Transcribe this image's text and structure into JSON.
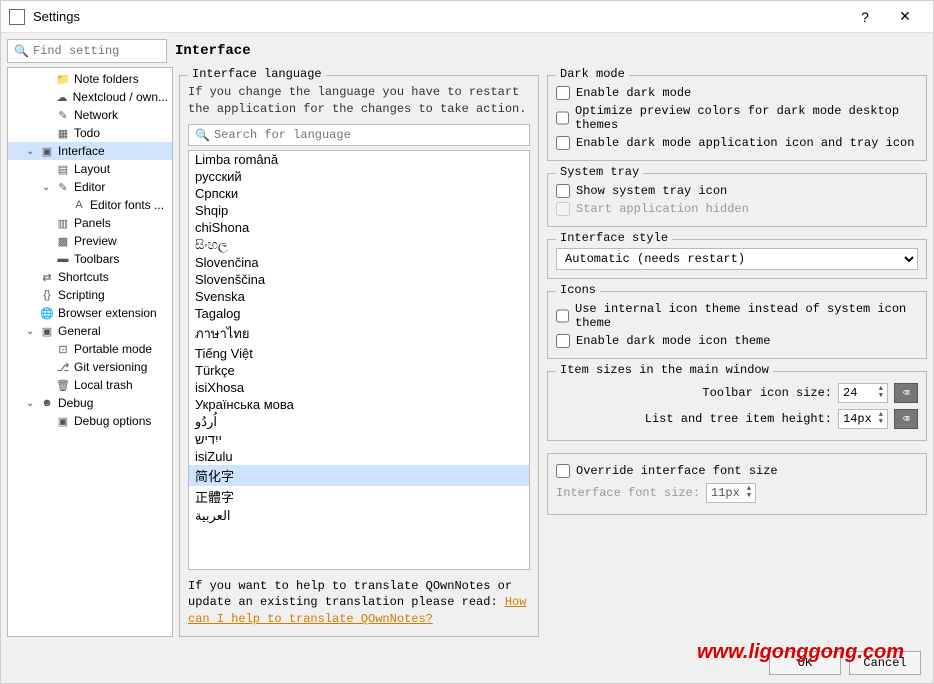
{
  "window": {
    "title": "Settings"
  },
  "search": {
    "placeholder": "Find setting"
  },
  "page_heading": "Interface",
  "sidebar": {
    "items": [
      {
        "label": "Note folders",
        "icon": "folder",
        "indent": 1
      },
      {
        "label": "Nextcloud / own...",
        "icon": "cloud",
        "indent": 1
      },
      {
        "label": "Network",
        "icon": "pen",
        "indent": 1
      },
      {
        "label": "Todo",
        "icon": "todo",
        "indent": 1
      },
      {
        "label": "Interface",
        "icon": "window",
        "indent": 0,
        "expanded": true,
        "selected": true
      },
      {
        "label": "Layout",
        "icon": "layout",
        "indent": 1
      },
      {
        "label": "Editor",
        "icon": "editor",
        "indent": 1,
        "expanded": true
      },
      {
        "label": "Editor fonts ...",
        "icon": "font",
        "indent": 2
      },
      {
        "label": "Panels",
        "icon": "panels",
        "indent": 1
      },
      {
        "label": "Preview",
        "icon": "preview",
        "indent": 1
      },
      {
        "label": "Toolbars",
        "icon": "toolbars",
        "indent": 1
      },
      {
        "label": "Shortcuts",
        "icon": "shortcuts",
        "indent": 0
      },
      {
        "label": "Scripting",
        "icon": "scripting",
        "indent": 0
      },
      {
        "label": "Browser extension",
        "icon": "globe",
        "indent": 0
      },
      {
        "label": "General",
        "icon": "general",
        "indent": 0,
        "expanded": true
      },
      {
        "label": "Portable mode",
        "icon": "portable",
        "indent": 1
      },
      {
        "label": "Git versioning",
        "icon": "git",
        "indent": 1
      },
      {
        "label": "Local trash",
        "icon": "trash",
        "indent": 1
      },
      {
        "label": "Debug",
        "icon": "debug",
        "indent": 0,
        "expanded": true
      },
      {
        "label": "Debug options",
        "icon": "debugopt",
        "indent": 1
      }
    ]
  },
  "lang_group": {
    "legend": "Interface language",
    "help": "If you change the language you have to restart the application for the changes to take action.",
    "search_placeholder": "Search for language",
    "items": [
      "Limba română",
      "русский",
      "Српски",
      "Shqip",
      "chiShona",
      "සිංහල",
      "Slovenčina",
      "Slovenščina",
      "Svenska",
      "Tagalog",
      "ภาษาไทย",
      "Tiếng Việt",
      "Türkçe",
      "isiXhosa",
      "Українська мова",
      "اُردُو",
      "ייִדיש",
      "isiZulu",
      "简化字",
      "正體字",
      "العربية"
    ],
    "selected_index": 18,
    "footer_text": "If you want to help to translate QOwnNotes or update an existing translation please read: ",
    "footer_link": "How can I help to translate QOwnNotes?"
  },
  "dark_mode": {
    "legend": "Dark mode",
    "opt1": "Enable dark mode",
    "opt2": "Optimize preview colors for dark mode desktop themes",
    "opt3": "Enable dark mode application icon and tray icon"
  },
  "system_tray": {
    "legend": "System tray",
    "opt1": "Show system tray icon",
    "opt2": "Start application hidden"
  },
  "iface_style": {
    "legend": "Interface style",
    "value": "Automatic (needs restart)"
  },
  "icons": {
    "legend": "Icons",
    "opt1": "Use internal icon theme instead of system icon theme",
    "opt2": "Enable dark mode icon theme"
  },
  "item_sizes": {
    "legend": "Item sizes in the main window",
    "toolbar_label": "Toolbar icon size:",
    "toolbar_value": "24",
    "list_label": "List and tree item height:",
    "list_value": "14px"
  },
  "font_override": {
    "check": "Override interface font size",
    "label": "Interface font size:",
    "value": "11px"
  },
  "buttons": {
    "ok": "OK",
    "cancel": "Cancel"
  },
  "watermark": "www.ligonggong.com"
}
